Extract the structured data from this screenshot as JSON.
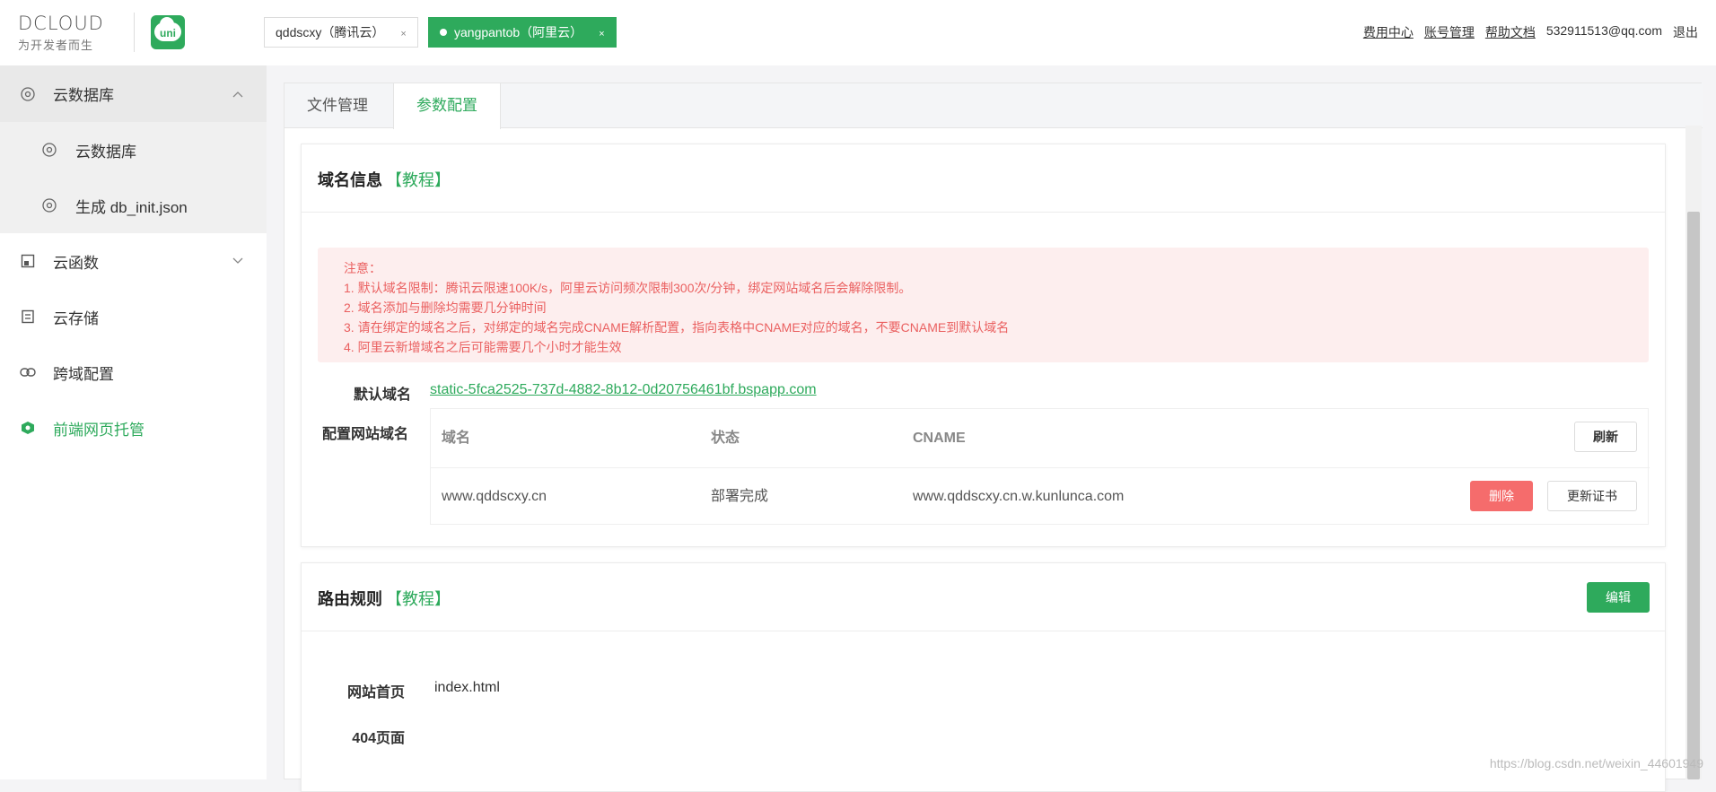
{
  "header": {
    "logo_text": "DCLOUD",
    "logo_slogan": "为开发者而生",
    "uni_logo_text": "uni",
    "space_tabs": [
      {
        "label": "qddscxy（腾讯云）",
        "close": "×"
      },
      {
        "label": "yangpantob（阿里云）",
        "close": "×"
      }
    ],
    "links": {
      "billing": "费用中心",
      "account": "账号管理",
      "docs": "帮助文档",
      "email": "532911513@qq.com",
      "logout": "退出"
    }
  },
  "sidebar": {
    "items": [
      {
        "label": "云数据库",
        "icon": "eye-icon"
      },
      {
        "label": "云数据库",
        "icon": "eye-icon"
      },
      {
        "label": "生成 db_init.json",
        "icon": "eye-icon"
      },
      {
        "label": "云函数",
        "icon": "function-icon"
      },
      {
        "label": "云存储",
        "icon": "storage-icon"
      },
      {
        "label": "跨域配置",
        "icon": "link-icon"
      },
      {
        "label": "前端网页托管",
        "icon": "hosting-icon"
      }
    ]
  },
  "main": {
    "tabs": [
      "文件管理",
      "参数配置"
    ],
    "domain_card": {
      "title": "域名信息",
      "tutorial": "【教程】",
      "notice": [
        "注意：",
        "1. 默认域名限制：腾讯云限速100K/s，阿里云访问频次限制300次/分钟，绑定网站域名后会解除限制。",
        "2. 域名添加与删除均需要几分钟时间",
        "3. 请在绑定的域名之后，对绑定的域名完成CNAME解析配置，指向表格中CNAME对应的域名，不要CNAME到默认域名",
        "4. 阿里云新增域名之后可能需要几个小时才能生效"
      ],
      "default_domain_label": "默认域名",
      "default_domain": "static-5fca2525-737d-4882-8b12-0d20756461bf.bspapp.com",
      "site_domain_label": "配置网站域名",
      "table": {
        "headers": [
          "域名",
          "状态",
          "CNAME"
        ],
        "refresh": "刷新",
        "rows": [
          {
            "domain": "www.qddscxy.cn",
            "status": "部署完成",
            "cname": "www.qddscxy.cn.w.kunlunca.com",
            "delete": "删除",
            "update_cert": "更新证书"
          }
        ]
      }
    },
    "route_card": {
      "title": "路由规则",
      "tutorial": "【教程】",
      "edit": "编辑",
      "home_label": "网站首页",
      "home_value": "index.html",
      "not_found_label": "404页面"
    }
  },
  "watermark": "https://blog.csdn.net/weixin_44601949"
}
